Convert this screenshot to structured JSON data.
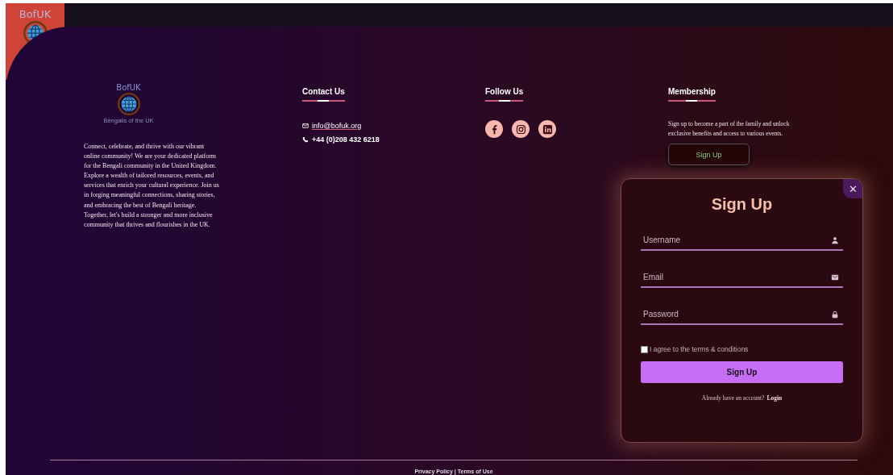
{
  "header": {
    "logo_text": "BofUK"
  },
  "footer": {
    "about": {
      "logo_text": "BofUK",
      "tagline": "Bengalis of the UK",
      "description": "Connect, celebrate, and thrive with our vibrant online community! We are your dedicated platform for the Bengali community in the United Kingdom. Explore a wealth of tailored resources, events, and services that enrich your cultural experience. Join us in forging meaningful connections, sharing stories, and embracing the best of Bengali heritage. Together, let's build a stronger and more inclusive community that thrives and flourishes in the UK."
    },
    "contact": {
      "heading": "Contact Us",
      "items": [
        {
          "kind": "email",
          "text": "info@bofuk.org"
        },
        {
          "kind": "phone",
          "text": "+44 (0)208 432 6218"
        }
      ]
    },
    "follow": {
      "heading": "Follow Us",
      "links": [
        {
          "kind": "facebook"
        },
        {
          "kind": "instagram"
        },
        {
          "kind": "linkedin"
        }
      ]
    },
    "membership": {
      "heading": "Membership",
      "text": "Sign up to become a part of the family and unlock exclusive benefits and access to various events.",
      "button": "Sign Up"
    },
    "bottom_links": "Privacy Policy | Terms of Use"
  },
  "modal": {
    "title": "Sign Up",
    "close": "✕",
    "fields": [
      {
        "kind": "user",
        "placeholder": "Username"
      },
      {
        "kind": "email",
        "placeholder": "Email"
      },
      {
        "kind": "lock",
        "placeholder": "Password"
      }
    ],
    "terms": {
      "label": "I agree to the terms & conditions",
      "checked": false
    },
    "submit": "Sign Up",
    "login_prompt": "Already have an account?",
    "login_link": "Login"
  }
}
